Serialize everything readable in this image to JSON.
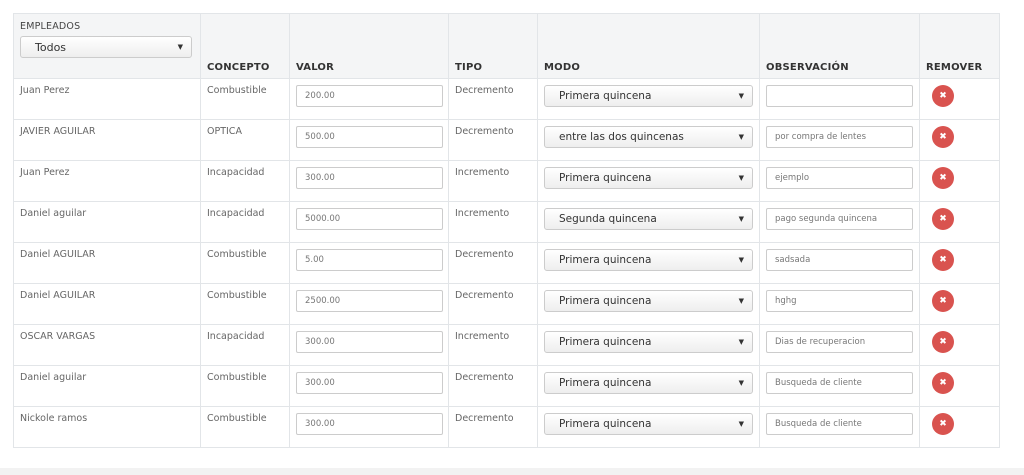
{
  "headers": {
    "empleados": "EMPLEADOS",
    "concepto": "CONCEPTO",
    "valor": "VALOR",
    "tipo": "TIPO",
    "modo": "MODO",
    "observacion": "OBSERVACIÓN",
    "remover": "REMOVER"
  },
  "filter": {
    "selected": "Todos"
  },
  "colors": {
    "remove_button": "#d9534f",
    "header_bg": "#f4f5f6",
    "border": "#e2e5e8"
  },
  "icons": {
    "remove": "close-icon",
    "dropdown": "caret-down-icon"
  },
  "rows": [
    {
      "empleado": "Juan Perez",
      "concepto": "Combustible",
      "valor": "200.00",
      "tipo": "Decremento",
      "modo": "Primera quincena",
      "observacion": ""
    },
    {
      "empleado": "JAVIER AGUILAR",
      "concepto": "OPTICA",
      "valor": "500.00",
      "tipo": "Decremento",
      "modo": "entre las dos quincenas",
      "observacion": "por compra de lentes"
    },
    {
      "empleado": "Juan Perez",
      "concepto": "Incapacidad",
      "valor": "300.00",
      "tipo": "Incremento",
      "modo": "Primera quincena",
      "observacion": "ejemplo"
    },
    {
      "empleado": "Daniel aguilar",
      "concepto": "Incapacidad",
      "valor": "5000.00",
      "tipo": "Incremento",
      "modo": "Segunda quincena",
      "observacion": "pago segunda quincena"
    },
    {
      "empleado": "Daniel AGUILAR",
      "concepto": "Combustible",
      "valor": "5.00",
      "tipo": "Decremento",
      "modo": "Primera quincena",
      "observacion": "sadsada"
    },
    {
      "empleado": "Daniel AGUILAR",
      "concepto": "Combustible",
      "valor": "2500.00",
      "tipo": "Decremento",
      "modo": "Primera quincena",
      "observacion": "hghg"
    },
    {
      "empleado": "OSCAR VARGAS",
      "concepto": "Incapacidad",
      "valor": "300.00",
      "tipo": "Incremento",
      "modo": "Primera quincena",
      "observacion": "Dias de recuperacion"
    },
    {
      "empleado": "Daniel aguilar",
      "concepto": "Combustible",
      "valor": "300.00",
      "tipo": "Decremento",
      "modo": "Primera quincena",
      "observacion": "Busqueda de cliente"
    },
    {
      "empleado": "Nickole ramos",
      "concepto": "Combustible",
      "valor": "300.00",
      "tipo": "Decremento",
      "modo": "Primera quincena",
      "observacion": "Busqueda de cliente"
    }
  ]
}
